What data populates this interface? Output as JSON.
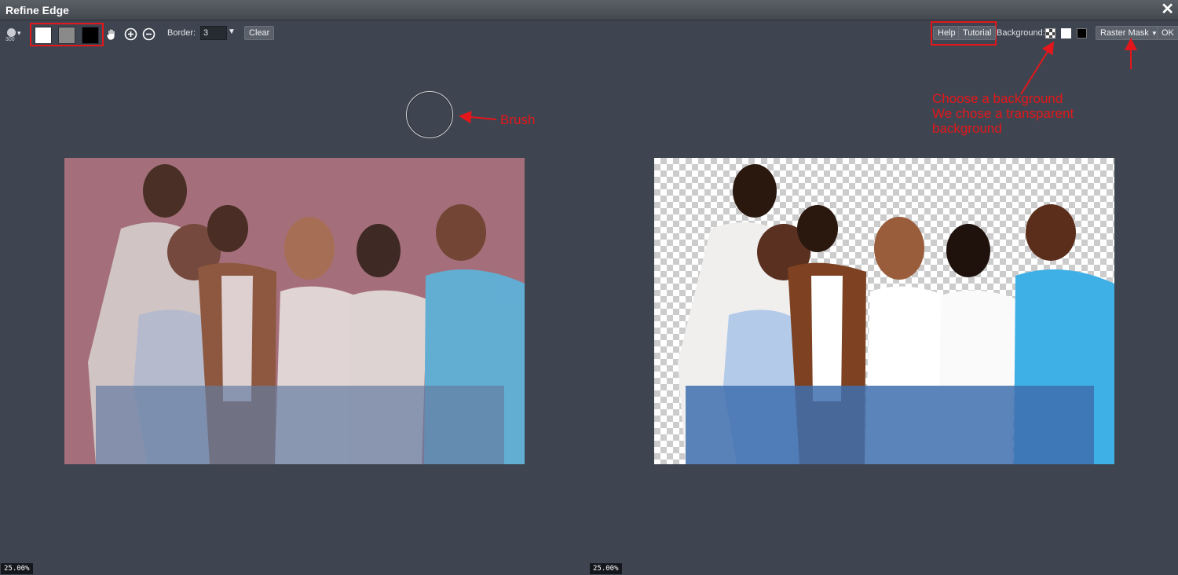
{
  "window": {
    "title": "Refine Edge",
    "close_glyph": "✕"
  },
  "toolbar": {
    "brush_size": "300",
    "brush_caret": "▾",
    "swatch_colors": [
      "#ffffff",
      "#8a8a8a",
      "#000000"
    ],
    "border_label": "Border:",
    "border_value": "3",
    "border_caret": "▼",
    "clear_label": "Clear",
    "help_label": "Help",
    "tutorial_label": "Tutorial",
    "background_label": "Background:",
    "raster_mask_label": "Raster Mask",
    "ok_label": "OK"
  },
  "annotations": {
    "brush": "Brush",
    "background_note": "Choose a background\nWe chose a transparent\nbackground"
  },
  "canvases": {
    "left_zoom": "25.00%",
    "right_zoom": "25.00%"
  },
  "colors": {
    "annotation_red": "#e3171b",
    "panel_bg": "#3f4550",
    "mask_overlay": "#a46f7a"
  }
}
